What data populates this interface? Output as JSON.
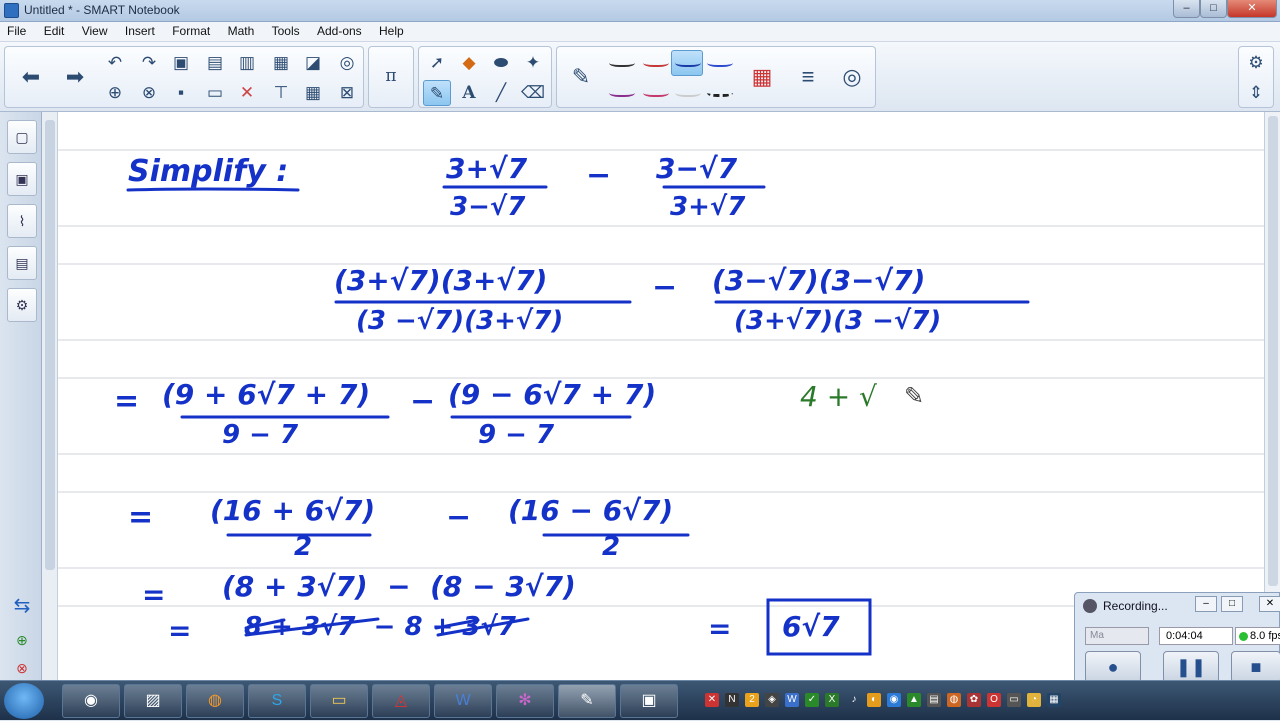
{
  "window": {
    "title": "Untitled * - SMART Notebook"
  },
  "menu": [
    "File",
    "Edit",
    "View",
    "Insert",
    "Format",
    "Math",
    "Tools",
    "Add-ons",
    "Help"
  ],
  "toolbar": {
    "icons": {
      "back": "arrow-left-icon",
      "forward": "arrow-right-icon",
      "undo": "undo-icon",
      "redo": "redo-icon",
      "math": "pi-icon",
      "text": "A"
    },
    "active_tool": "pens",
    "accent": "#8cc6f0"
  },
  "recorder": {
    "title": "Recording...",
    "mode": "Ma",
    "elapsed": "0:04:04",
    "fps": "8.0 fps"
  },
  "notebook": {
    "ink_color": "#1432c8",
    "aside_ink_color": "#2a7a2a",
    "lines": {
      "l1": "Simplify :",
      "l1_frac1_num": "3+√7",
      "l1_frac1_den": "3−√7",
      "l1_minus": "−",
      "l1_frac2_num": "3−√7",
      "l1_frac2_den": "3+√7",
      "l2_num1": "(3+√7)(3+√7)",
      "l2_den1": "(3 −√7)(3+√7)",
      "l2_num2": "(3−√7)(3−√7)",
      "l2_den2": "(3+√7)(3 −√7)",
      "l3_eq": "=",
      "l3_num1": "(9 + 6√7 + 7)",
      "l3_den1": "9 − 7",
      "l3_num2": "(9 − 6√7 + 7)",
      "l3_den2": "9 − 7",
      "aside": "4 + √",
      "l4_eq": "=",
      "l4_num1": "(16 + 6√7)",
      "l4_den1": "2",
      "l4_num2": "(16 − 6√7)",
      "l4_den2": "2",
      "l5_eq": "=",
      "l5_text": "(8 + 3√7)  −  (8 − 3√7)",
      "l6_eq": "=",
      "l6_text": "8 + 3√7  − 8 + 3√7",
      "l6_eq2": "=",
      "answer": "6√7"
    }
  }
}
